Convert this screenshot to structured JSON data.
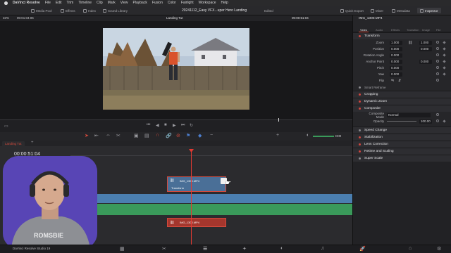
{
  "menubar": {
    "app": "DaVinci Resolve",
    "items": [
      "File",
      "Edit",
      "Trim",
      "Timeline",
      "Clip",
      "Mark",
      "View",
      "Playback",
      "Fusion",
      "Color",
      "Fairlight",
      "Workspace",
      "Help"
    ]
  },
  "toolbar": {
    "media_pool": "Media Pool",
    "effects": "Effects",
    "index": "Index",
    "sound_library": "Sound Library",
    "project_title": "20241112_Easy VFX...uper Hero Landing",
    "status": "Edited",
    "quick_export": "Quick Export",
    "mixer": "Mixer",
    "metadata": "Metadata",
    "inspector": "Inspector"
  },
  "viewer": {
    "zoom": "33%",
    "source_timecode": "00:01:04:06",
    "timeline_name": "Landing Tut",
    "record_timecode": "00:00:51:04"
  },
  "timeline": {
    "tab": "Landing Tut",
    "timecode": "00:00:51:04",
    "video_clip": "IMG_1300.MP4",
    "transform_label": "Transform",
    "audio_clip": "IMG_1300.MP4",
    "zoom_label": "DIM"
  },
  "inspector": {
    "clip_name": "IMG_1300.MP4",
    "tabs": [
      "Video",
      "Audio",
      "Effects",
      "Transition",
      "Image",
      "File"
    ],
    "transform": {
      "title": "Transform",
      "zoom": {
        "label": "Zoom",
        "x": "1.000",
        "y": "1.000"
      },
      "position": {
        "label": "Position",
        "x": "0.000",
        "y": "0.000"
      },
      "rotation": {
        "label": "Rotation Angle",
        "value": "0.000"
      },
      "anchor": {
        "label": "Anchor Point",
        "x": "0.000",
        "y": "0.000"
      },
      "pitch": {
        "label": "Pitch",
        "value": "0.000"
      },
      "yaw": {
        "label": "Yaw",
        "value": "0.000"
      },
      "flip": {
        "label": "Flip"
      }
    },
    "smart_reframe": "Smart Reframe",
    "cropping": "Cropping",
    "dynamic_zoom": "Dynamic Zoom",
    "composite": {
      "title": "Composite",
      "mode_label": "Composite Mode",
      "mode_value": "Normal",
      "opacity_label": "Opacity",
      "opacity_value": "100.00"
    },
    "speed_change": "Speed Change",
    "stabilization": "Stabilization",
    "lens_correction": "Lens Correction",
    "retime": "Retime and Scaling",
    "super_scale": "Super Scale"
  },
  "statusbar": {
    "app_version": "DaVinci Resolve Studio 19"
  },
  "webcam": {
    "sweatshirt_text": "ROMSBIE"
  },
  "colors": {
    "accent_red": "#d44a3c",
    "video_track": "#4b7fb0",
    "audio_track": "#3a9a5a",
    "playhead": "#e33a32"
  }
}
